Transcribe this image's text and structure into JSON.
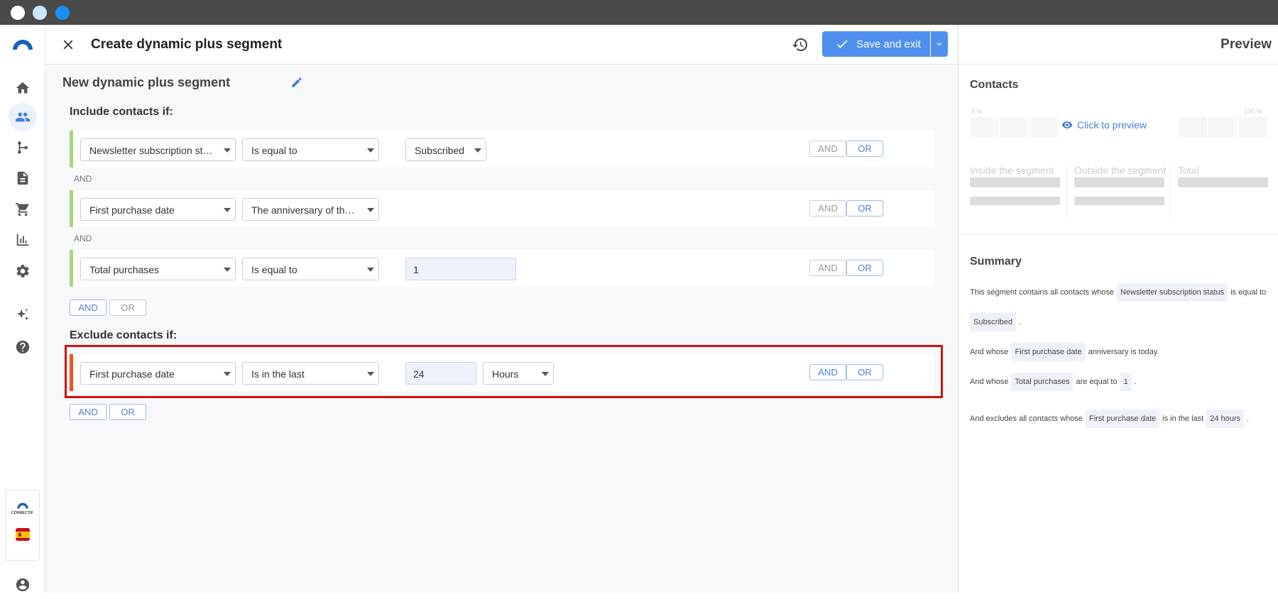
{
  "window": {
    "controls": [
      "close",
      "minimize",
      "maximize"
    ]
  },
  "nav": {
    "items": [
      "home",
      "contacts",
      "workflows",
      "content",
      "commerce",
      "analytics",
      "settings",
      "ai",
      "help"
    ],
    "brand_word": "CONNECTIF",
    "active": "contacts"
  },
  "header": {
    "title": "Create dynamic plus segment",
    "save_label": "Save and exit"
  },
  "segment": {
    "name": "New dynamic plus segment",
    "include_title": "Include contacts if:",
    "exclude_title": "Exclude contacts if:",
    "and_separator": "AND",
    "include_rules": [
      {
        "field": "Newsletter subscription status",
        "operator": "Is equal to",
        "value": "Subscribed",
        "value_type": "select"
      },
      {
        "field": "First purchase date",
        "operator": "The anniversary of the date is today",
        "value": "",
        "value_type": "none"
      },
      {
        "field": "Total purchases",
        "operator": "Is equal to",
        "value": "1",
        "value_type": "input"
      }
    ],
    "exclude_rules": [
      {
        "field": "First purchase date",
        "operator": "Is in the last",
        "value": "24",
        "unit": "Hours"
      }
    ],
    "and_label": "AND",
    "or_label": "OR"
  },
  "preview": {
    "title": "Preview",
    "contacts_title": "Contacts",
    "pct_min": "0 %",
    "pct_max": "100 %",
    "click_to_preview": "Click to preview",
    "inside_label": "Inside the segment",
    "outside_label": "Outside the segment",
    "total_label": "Total",
    "summary_title": "Summary",
    "summary": {
      "l1_pre": "This segment contains all contacts whose",
      "l1_chip": "Newsletter subscription status",
      "l1_post": "is equal to",
      "l2_chip": "Subscribed",
      "l2_post": ".",
      "l3_pre": "And whose",
      "l3_chip": "First purchase date",
      "l3_post": "anniversary is today.",
      "l4_pre": "And whose",
      "l4_chip": "Total purchases",
      "l4_mid": "are equal to",
      "l4_chip2": "1",
      "l4_post": ".",
      "l5_pre": "And excludes all contacts whose",
      "l5_chip": "First purchase date",
      "l5_mid": "is in the last",
      "l5_chip2": "24 hours",
      "l5_post": "."
    }
  },
  "colors": {
    "accent": "#4f90ef",
    "include_bar": "#a6d67a",
    "exclude_bar": "#f0521e",
    "highlight": "#d01010"
  }
}
